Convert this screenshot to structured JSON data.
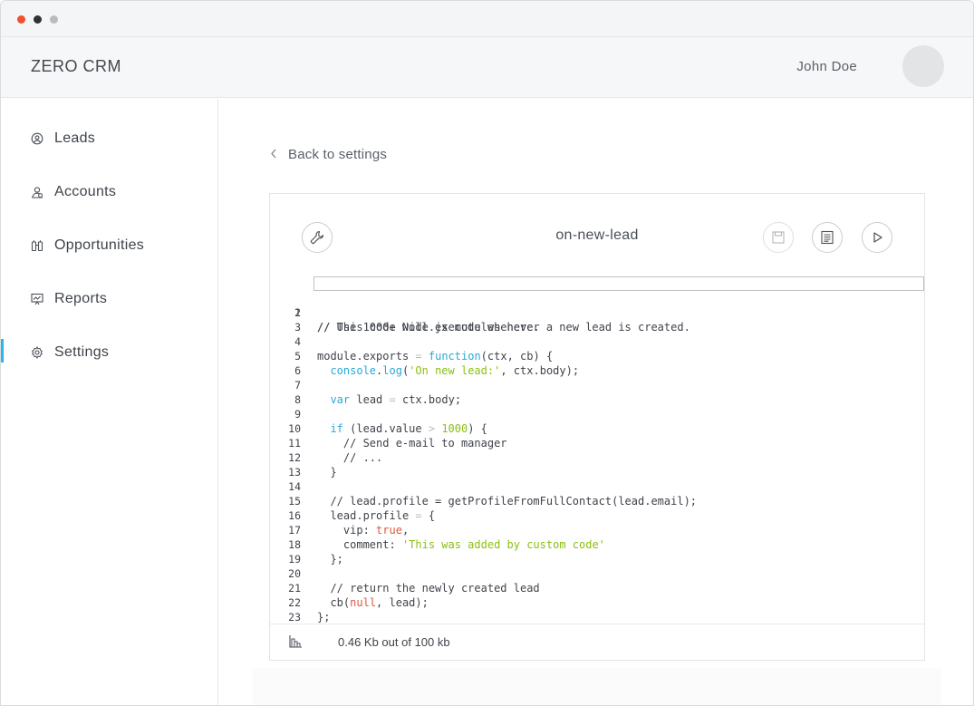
{
  "window": {
    "controls": [
      "close",
      "minimize",
      "maximize"
    ]
  },
  "header": {
    "brand": "ZERO CRM",
    "user_name": "John Doe"
  },
  "sidebar": {
    "items": [
      {
        "label": "Leads",
        "icon": "leads-icon"
      },
      {
        "label": "Accounts",
        "icon": "accounts-icon"
      },
      {
        "label": "Opportunities",
        "icon": "opportunities-icon"
      },
      {
        "label": "Reports",
        "icon": "reports-icon"
      },
      {
        "label": "Settings",
        "icon": "settings-icon",
        "active": true
      }
    ],
    "accent_color": "#29b6e8"
  },
  "main": {
    "back_label": "Back to settings",
    "editor": {
      "script_name": "on-new-lead",
      "toolbar_icons": [
        "wrench-icon",
        "save-icon",
        "log-icon",
        "run-icon"
      ],
      "line_numbers": [
        "1",
        "2",
        "3",
        "4",
        "5",
        "6",
        "7",
        "8",
        "9",
        "10",
        "11",
        "12",
        "13",
        "14",
        "15",
        "16",
        "17",
        "18",
        "19",
        "20",
        "21",
        "22",
        "23"
      ],
      "code_lines": [
        "// This code will execute whenever a new lead is created.",
        "// Use 1000+ Node.js modules here.",
        "",
        "module.exports = function(ctx, cb) {",
        "  console.log('On new lead:', ctx.body);",
        "",
        "  var lead = ctx.body;",
        "",
        "  if (lead.value > 1000) {",
        "    // Send e-mail to manager",
        "    // ...",
        "  }",
        "",
        "  // lead.profile = getProfileFromFullContact(lead.email);",
        "  lead.profile = {",
        "    vip: true,",
        "    comment: 'This was added by custom code'",
        "  };",
        "",
        "  // return the newly created lead",
        "  cb(null, lead);",
        "};",
        ""
      ],
      "syntax_colors": {
        "comment": "#b9bcc0",
        "keyword": "#2aa9d8",
        "string": "#8bc012",
        "null": "#e0583c"
      },
      "usage_text": "0.46 Kb out of 100 kb"
    }
  }
}
